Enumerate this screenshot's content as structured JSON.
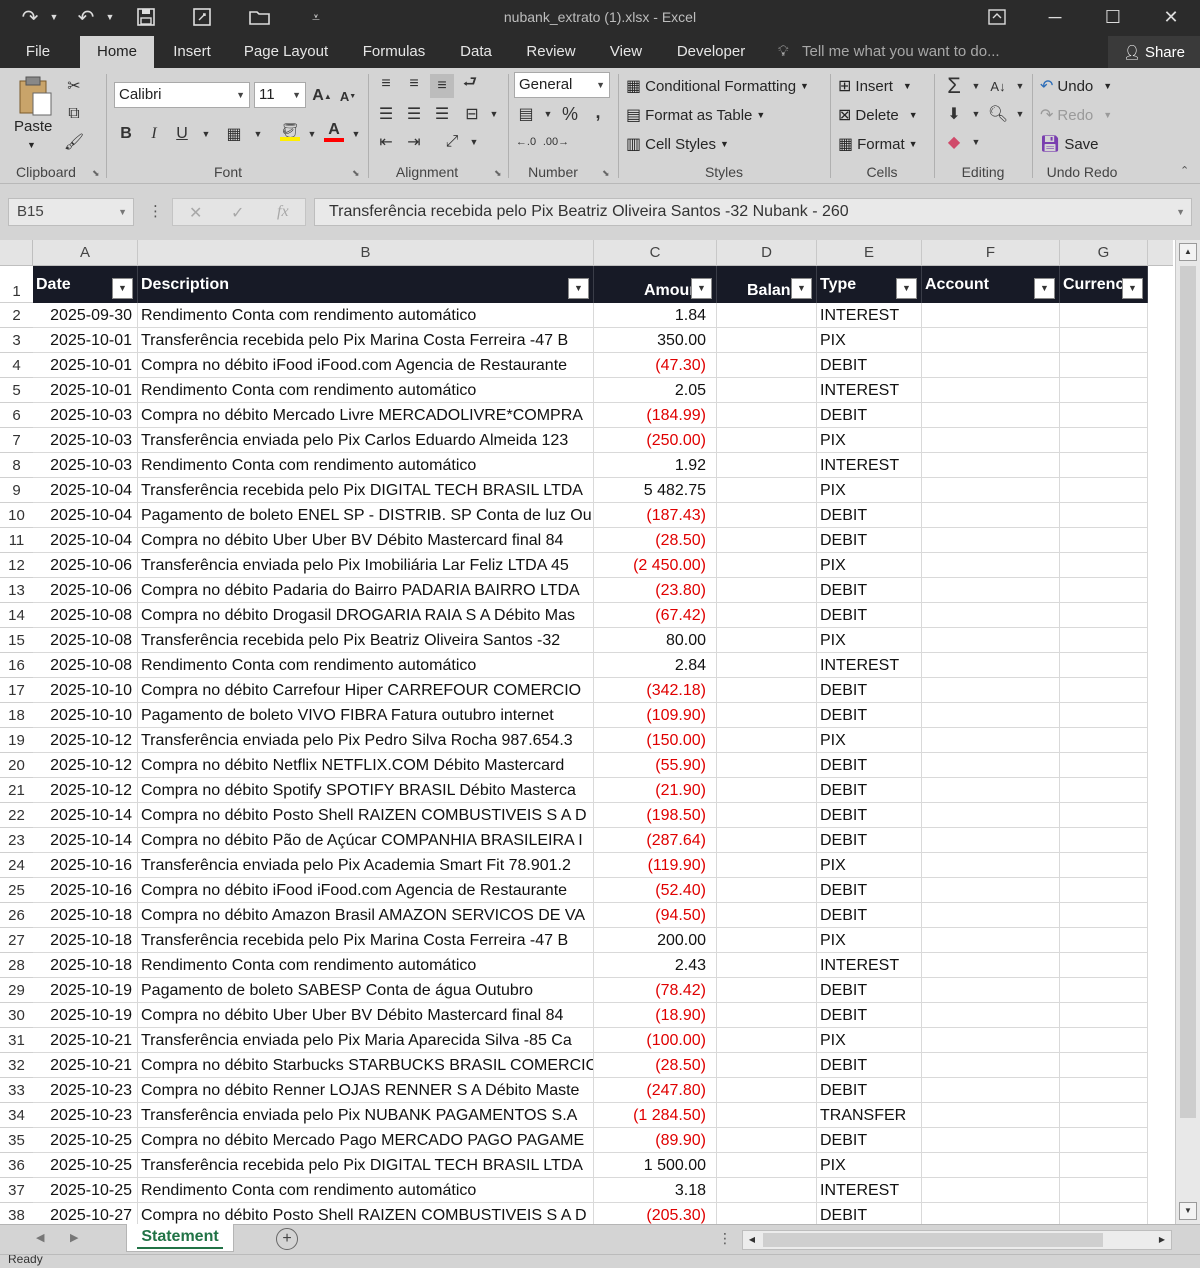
{
  "window": {
    "title": "nubank_extrato (1).xlsx - Excel"
  },
  "tabs": {
    "file": "File",
    "home": "Home",
    "insert": "Insert",
    "page_layout": "Page Layout",
    "formulas": "Formulas",
    "data": "Data",
    "review": "Review",
    "view": "View",
    "developer": "Developer",
    "tell_me": "Tell me what you want to do...",
    "share": "Share"
  },
  "ribbon": {
    "clipboard": {
      "paste": "Paste",
      "label": "Clipboard"
    },
    "font": {
      "name": "Calibri",
      "size": "11",
      "label": "Font"
    },
    "alignment": {
      "label": "Alignment"
    },
    "number": {
      "format": "General",
      "label": "Number"
    },
    "styles": {
      "conditional": "Conditional Formatting",
      "format_table": "Format as Table",
      "cell_styles": "Cell Styles",
      "label": "Styles"
    },
    "cells": {
      "insert": "Insert",
      "delete": "Delete",
      "format": "Format",
      "label": "Cells"
    },
    "editing": {
      "label": "Editing"
    },
    "undo_redo": {
      "undo": "Undo",
      "redo": "Redo",
      "save": "Save",
      "label": "Undo Redo"
    }
  },
  "formula_bar": {
    "name_box": "B15",
    "fx": "fx",
    "formula": "Transferência recebida pelo Pix Beatriz Oliveira Santos -32 Nubank - 260"
  },
  "grid": {
    "columns": [
      "A",
      "B",
      "C",
      "D",
      "E",
      "F",
      "G"
    ],
    "headers": {
      "date": "Date",
      "description": "Description",
      "amount": "Amount",
      "balance": "Balance",
      "type": "Type",
      "account": "Account",
      "currency": "Currency"
    },
    "rows": [
      [
        "2025-09-30",
        "Rendimento Conta com rendimento automático",
        "1.84",
        "",
        "INTEREST"
      ],
      [
        "2025-10-01",
        "Transferência recebida pelo Pix Marina Costa Ferreira -47 B",
        "350.00",
        "",
        "PIX"
      ],
      [
        "2025-10-01",
        "Compra no débito iFood iFood.com Agencia de Restaurante",
        "(47.30)",
        "",
        "DEBIT"
      ],
      [
        "2025-10-01",
        "Rendimento Conta com rendimento automático",
        "2.05",
        "",
        "INTEREST"
      ],
      [
        "2025-10-03",
        "Compra no débito Mercado Livre MERCADOLIVRE*COMPRA",
        "(184.99)",
        "",
        "DEBIT"
      ],
      [
        "2025-10-03",
        "Transferência enviada pelo Pix Carlos Eduardo Almeida 123",
        "(250.00)",
        "",
        "PIX"
      ],
      [
        "2025-10-03",
        "Rendimento Conta com rendimento automático",
        "1.92",
        "",
        "INTEREST"
      ],
      [
        "2025-10-04",
        "Transferência recebida pelo Pix DIGITAL TECH BRASIL LTDA",
        "5 482.75",
        "",
        "PIX"
      ],
      [
        "2025-10-04",
        "Pagamento de boleto ENEL SP - DISTRIB. SP Conta de luz Ou",
        "(187.43)",
        "",
        "DEBIT"
      ],
      [
        "2025-10-04",
        "Compra no débito Uber Uber BV Débito Mastercard final 84",
        "(28.50)",
        "",
        "DEBIT"
      ],
      [
        "2025-10-06",
        "Transferência enviada pelo Pix Imobiliária Lar Feliz LTDA 45",
        "(2 450.00)",
        "",
        "PIX"
      ],
      [
        "2025-10-06",
        "Compra no débito Padaria do Bairro PADARIA BAIRRO LTDA",
        "(23.80)",
        "",
        "DEBIT"
      ],
      [
        "2025-10-08",
        "Compra no débito Drogasil DROGARIA RAIA S A Débito Mas",
        "(67.42)",
        "",
        "DEBIT"
      ],
      [
        "2025-10-08",
        "Transferência recebida pelo Pix Beatriz Oliveira Santos -32",
        "80.00",
        "",
        "PIX"
      ],
      [
        "2025-10-08",
        "Rendimento Conta com rendimento automático",
        "2.84",
        "",
        "INTEREST"
      ],
      [
        "2025-10-10",
        "Compra no débito Carrefour Hiper CARREFOUR COMERCIO",
        "(342.18)",
        "",
        "DEBIT"
      ],
      [
        "2025-10-10",
        "Pagamento de boleto VIVO FIBRA Fatura outubro internet",
        "(109.90)",
        "",
        "DEBIT"
      ],
      [
        "2025-10-12",
        "Transferência enviada pelo Pix Pedro Silva Rocha 987.654.3",
        "(150.00)",
        "",
        "PIX"
      ],
      [
        "2025-10-12",
        "Compra no débito Netflix NETFLIX.COM Débito Mastercard",
        "(55.90)",
        "",
        "DEBIT"
      ],
      [
        "2025-10-12",
        "Compra no débito Spotify SPOTIFY BRASIL Débito Masterca",
        "(21.90)",
        "",
        "DEBIT"
      ],
      [
        "2025-10-14",
        "Compra no débito Posto Shell RAIZEN COMBUSTIVEIS S A D",
        "(198.50)",
        "",
        "DEBIT"
      ],
      [
        "2025-10-14",
        "Compra no débito Pão de Açúcar COMPANHIA BRASILEIRA I",
        "(287.64)",
        "",
        "DEBIT"
      ],
      [
        "2025-10-16",
        "Transferência enviada pelo Pix Academia Smart Fit 78.901.2",
        "(119.90)",
        "",
        "PIX"
      ],
      [
        "2025-10-16",
        "Compra no débito iFood iFood.com Agencia de Restaurante",
        "(52.40)",
        "",
        "DEBIT"
      ],
      [
        "2025-10-18",
        "Compra no débito Amazon Brasil AMAZON SERVICOS DE VA",
        "(94.50)",
        "",
        "DEBIT"
      ],
      [
        "2025-10-18",
        "Transferência recebida pelo Pix Marina Costa Ferreira -47 B",
        "200.00",
        "",
        "PIX"
      ],
      [
        "2025-10-18",
        "Rendimento Conta com rendimento automático",
        "2.43",
        "",
        "INTEREST"
      ],
      [
        "2025-10-19",
        "Pagamento de boleto SABESP Conta de água Outubro",
        "(78.42)",
        "",
        "DEBIT"
      ],
      [
        "2025-10-19",
        "Compra no débito Uber Uber BV Débito Mastercard final 84",
        "(18.90)",
        "",
        "DEBIT"
      ],
      [
        "2025-10-21",
        "Transferência enviada pelo Pix Maria Aparecida Silva -85 Ca",
        "(100.00)",
        "",
        "PIX"
      ],
      [
        "2025-10-21",
        "Compra no débito Starbucks STARBUCKS BRASIL COMERCIO",
        "(28.50)",
        "",
        "DEBIT"
      ],
      [
        "2025-10-23",
        "Compra no débito Renner LOJAS RENNER S A Débito Maste",
        "(247.80)",
        "",
        "DEBIT"
      ],
      [
        "2025-10-23",
        "Transferência enviada pelo Pix NUBANK PAGAMENTOS S.A",
        "(1 284.50)",
        "",
        "TRANSFER"
      ],
      [
        "2025-10-25",
        "Compra no débito Mercado Pago MERCADO PAGO PAGAME",
        "(89.90)",
        "",
        "DEBIT"
      ],
      [
        "2025-10-25",
        "Transferência recebida pelo Pix DIGITAL TECH BRASIL LTDA",
        "1 500.00",
        "",
        "PIX"
      ],
      [
        "2025-10-25",
        "Rendimento Conta com rendimento automático",
        "3.18",
        "",
        "INTEREST"
      ],
      [
        "2025-10-27",
        "Compra no débito Posto Shell RAIZEN COMBUSTIVEIS S A D",
        "(205.30)",
        "",
        "DEBIT"
      ]
    ]
  },
  "sheet_tabs": {
    "active": "Statement"
  },
  "status": {
    "text": "Ready"
  },
  "colors": {
    "header_bg": "#171a26",
    "negative": "#e00000",
    "sheet_tab": "#217346"
  }
}
